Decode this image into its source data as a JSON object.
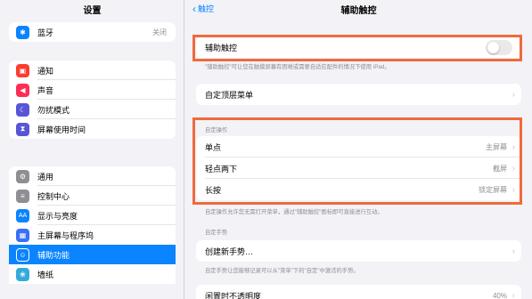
{
  "sidebar": {
    "title": "设置",
    "bluetooth": {
      "label": "蓝牙",
      "value": "关闭"
    },
    "group2": [
      {
        "label": "通知",
        "icon": "bell-icon",
        "color": "#ff3b30"
      },
      {
        "label": "声音",
        "icon": "speaker-icon",
        "color": "#ff2d55"
      },
      {
        "label": "勿扰模式",
        "icon": "moon-icon",
        "color": "#5856d6"
      },
      {
        "label": "屏幕使用时间",
        "icon": "hourglass-icon",
        "color": "#5856d6"
      }
    ],
    "group3": [
      {
        "label": "通用",
        "icon": "gear-icon",
        "color": "#8e8e93"
      },
      {
        "label": "控制中心",
        "icon": "control-center-icon",
        "color": "#8e8e93"
      },
      {
        "label": "显示与亮度",
        "icon": "display-icon",
        "color": "#0a84ff",
        "glyph": "AA"
      },
      {
        "label": "主屏幕与程序坞",
        "icon": "home-grid-icon",
        "color": "#3a6ff7"
      },
      {
        "label": "辅助功能",
        "icon": "accessibility-icon",
        "color": "#0a84ff"
      },
      {
        "label": "墙纸",
        "icon": "wallpaper-icon",
        "color": "#34aadc"
      }
    ]
  },
  "main": {
    "back_label": "触控",
    "title": "辅助触控",
    "assistive_touch": {
      "label": "辅助触控",
      "enabled": false
    },
    "assistive_touch_note": "\"辅助触控\"可让您在触摸屏幕有困难或需要自适应配件的情况下使用 iPad。",
    "custom_menu_label": "自定顶层菜单",
    "custom_actions_header": "自定操作",
    "actions": [
      {
        "label": "单点",
        "value": "主屏幕"
      },
      {
        "label": "轻点两下",
        "value": "截屏"
      },
      {
        "label": "长按",
        "value": "锁定屏幕"
      }
    ],
    "actions_note": "自定操作允许您无需打开菜单，通过\"辅助触控\"图标即可直接进行互动。",
    "custom_gestures_header": "自定手势",
    "create_gesture_label": "创建新手势…",
    "gestures_note": "自定手势让您能够记录可以从\"菜单\"下的\"自定\"中激活的手势。",
    "idle_opacity": {
      "label": "闲置时不透明度",
      "value": "40%"
    }
  },
  "colors": {
    "highlight": "#f06a3c",
    "accent": "#0a84ff"
  }
}
